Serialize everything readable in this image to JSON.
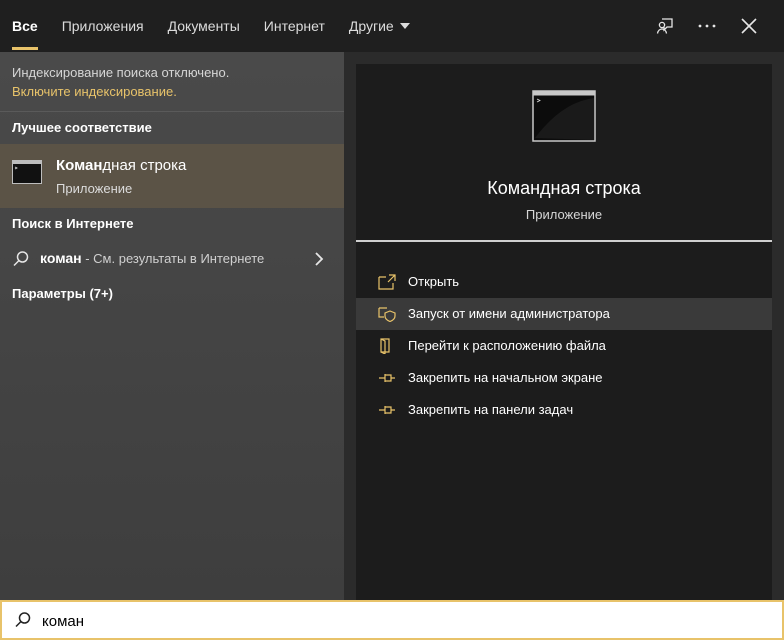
{
  "tabs": [
    {
      "label": "Все",
      "active": true
    },
    {
      "label": "Приложения"
    },
    {
      "label": "Документы"
    },
    {
      "label": "Интернет"
    },
    {
      "label": "Другие"
    }
  ],
  "index": {
    "note": "Индексирование поиска отключено.",
    "link": "Включите индексирование."
  },
  "best_match": {
    "title": "Лучшее соответствие",
    "name_bold": "Коман",
    "name_rest": "дная строка",
    "type": "Приложение"
  },
  "web": {
    "title": "Поиск в Интернете",
    "query": "коман",
    "suffix": " - См. результаты в Интернете"
  },
  "settings": {
    "title": "Параметры (7+)"
  },
  "preview": {
    "title": "Командная строка",
    "subtitle": "Приложение"
  },
  "actions": [
    {
      "label": "Открыть",
      "icon": "open-icon"
    },
    {
      "label": "Запуск от имени администратора",
      "icon": "admin-shield-icon"
    },
    {
      "label": "Перейти к расположению файла",
      "icon": "file-location-icon"
    },
    {
      "label": "Закрепить на начальном экране",
      "icon": "pin-icon"
    },
    {
      "label": "Закрепить на панели задач",
      "icon": "pin-icon"
    }
  ],
  "search": {
    "value": "коман"
  },
  "colors": {
    "accent": "#e8c36a",
    "selected_bg": "#5b5346",
    "panel_bg": "#1c1c1c"
  }
}
